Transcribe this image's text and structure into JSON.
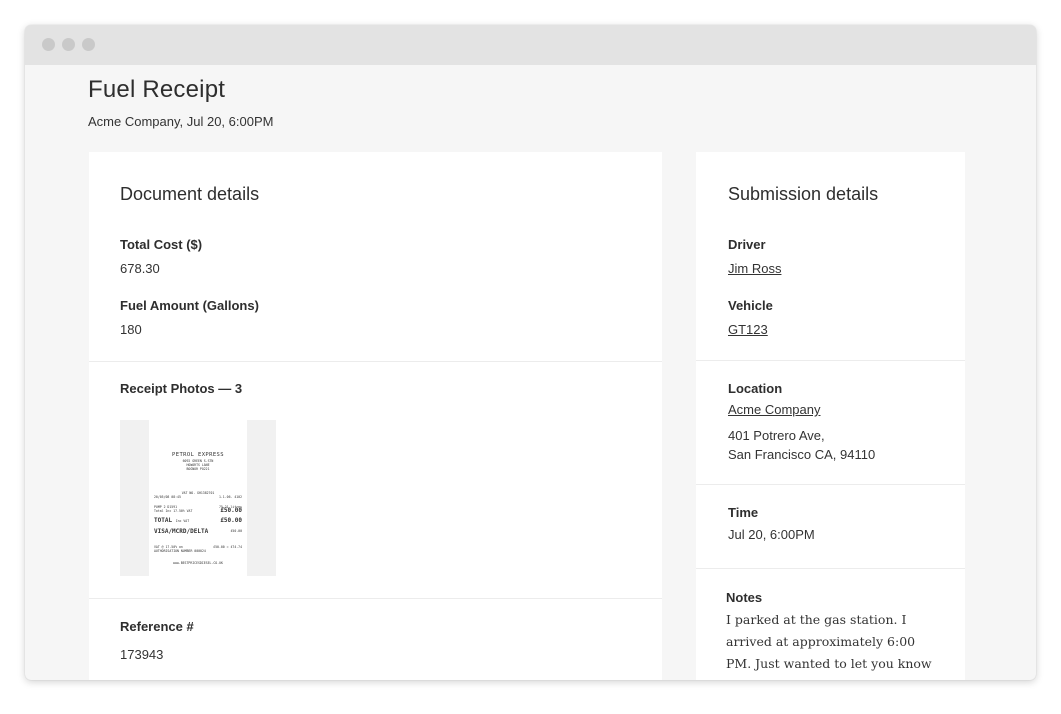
{
  "header": {
    "title": "Fuel Receipt",
    "subtitle": "Acme Company, Jul 20, 6:00PM"
  },
  "document": {
    "heading": "Document details",
    "total_cost_label": "Total Cost ($)",
    "total_cost_value": "678.30",
    "fuel_amount_label": "Fuel Amount (Gallons)",
    "fuel_amount_value": "180",
    "receipt_photos_label": "Receipt Photos — 3",
    "reference_label": "Reference #",
    "reference_value": "173943"
  },
  "receipt": {
    "brand": "PETROL EXPRESS",
    "lines": [
      "6092 GREEN S-STN",
      "HOWARTS LANE",
      "BOGNOR PO221"
    ],
    "vat_no": "VAT NO. GH1382701",
    "date": "20/05/08 08:45",
    "till": "1.1.06.  4102",
    "pump_label": "PUMP  2 D1591",
    "pump_qty": "75.21 litres",
    "vat_incl_label": "Total Inc 17.50% VAT",
    "vat_incl_value": "£50.00",
    "total_label": "TOTAL",
    "total_vat": "Inc VAT",
    "total_value": "£50.00",
    "card_label": "VISA/MCRD/DELTA",
    "card_value": "£50.00",
    "vat_detail_left": "VAT @ 17.50% on",
    "vat_detail_right": "£50.00 = £74.74",
    "auth": "AUTHORISATION NUMBER  000024",
    "website": "www.BESTPRICESDIESEL.CO.UK"
  },
  "submission": {
    "heading": "Submission details",
    "driver_label": "Driver",
    "driver_value": "Jim Ross",
    "vehicle_label": "Vehicle",
    "vehicle_value": "GT123",
    "location_label": "Location",
    "location_name": "Acme Company",
    "address_line1": "401 Potrero Ave,",
    "address_line2": "San Francisco CA, 94110",
    "time_label": "Time",
    "time_value": "Jul 20, 6:00PM",
    "notes_label": "Notes",
    "notes_value": "I parked at the gas station. I arrived at approximately 6:00 PM. Just wanted to let you know"
  }
}
